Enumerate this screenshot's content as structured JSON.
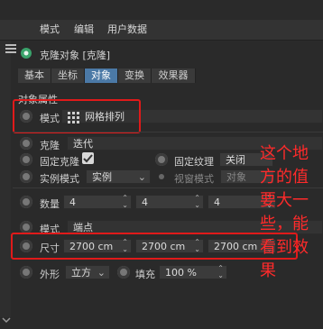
{
  "menu": {
    "items": [
      "模式",
      "编辑",
      "用户数据"
    ]
  },
  "object": {
    "title": "克隆对象 [克隆]"
  },
  "tabs": [
    {
      "label": "基本",
      "active": false
    },
    {
      "label": "坐标",
      "active": false
    },
    {
      "label": "对象",
      "active": true
    },
    {
      "label": "变换",
      "active": false
    },
    {
      "label": "效果器",
      "active": false
    }
  ],
  "section": {
    "title": "对象属性"
  },
  "props": {
    "mode_label": "模式",
    "mode_value": "网格排列",
    "clone_label": "克隆",
    "clone_value": "迭代",
    "fixed_clone_label": "固定克隆",
    "fixed_clone_checked": true,
    "fixed_texture_label": "固定纹理",
    "fixed_texture_value": "关闭",
    "instance_mode_label": "实例模式",
    "instance_mode_value": "实例",
    "viewport_mode_label": "视窗模式",
    "viewport_mode_value": "对象",
    "count_label": "数量",
    "count_values": [
      "4",
      "4",
      "4"
    ],
    "mode2_label": "模式",
    "mode2_value": "端点",
    "size_label": "尺寸",
    "size_values": [
      "2700 cm",
      "2700 cm",
      "2700 cm"
    ],
    "shape_label": "外形",
    "shape_value": "立方",
    "fill_label": "填充",
    "fill_value": "100 %"
  },
  "annotation": {
    "lines": [
      "这个地",
      "方的值",
      "要大一",
      "些，能",
      "看到效",
      "果"
    ]
  },
  "colors": {
    "accent_tab": "#4b79a6",
    "annotation_red": "#ff2a2a"
  }
}
